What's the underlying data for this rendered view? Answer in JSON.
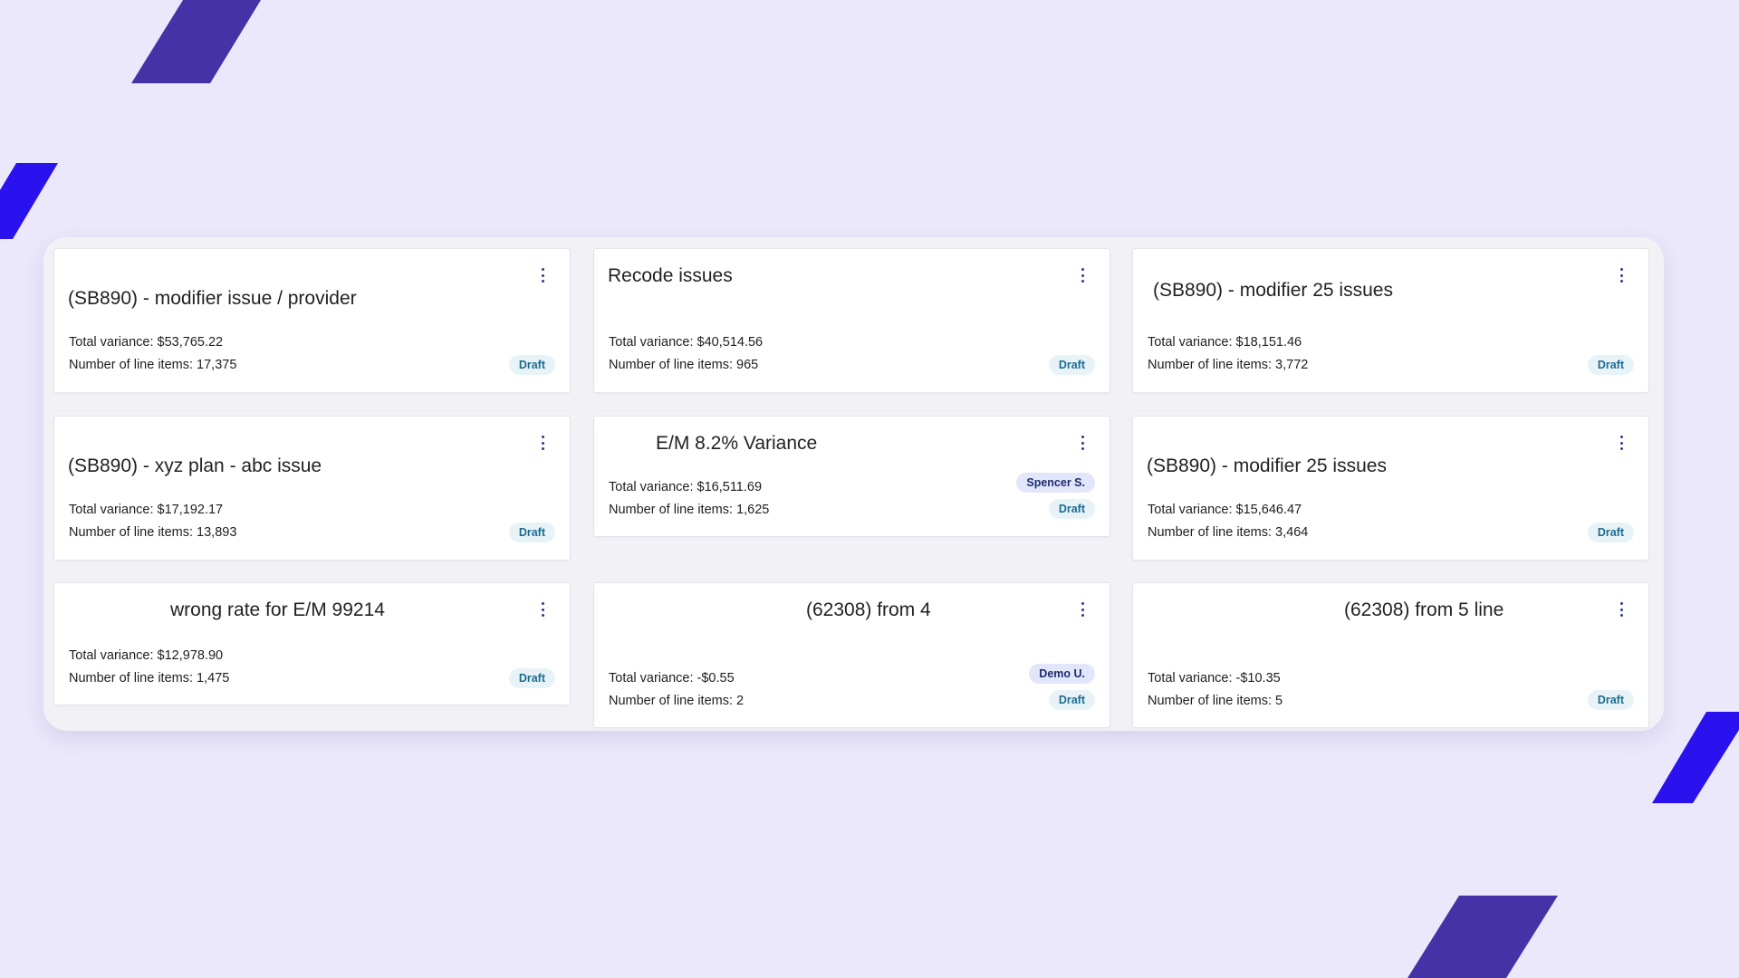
{
  "colors": {
    "background": "#ebe8fc",
    "panel": "#f2f1f6",
    "card": "#ffffff",
    "accent_dark": "#4532a6",
    "accent_bright": "#2a12ee",
    "draft_badge_bg": "#e8f3f8",
    "draft_badge_text": "#1d6b91",
    "user_badge_bg": "#e1e6fa",
    "user_badge_text": "#1f2b6e",
    "kebab_icon": "#2e3a8c"
  },
  "labels": {
    "total_variance": "Total variance: ",
    "line_items": "Number of line items: "
  },
  "cards": [
    {
      "title": "(SB890) - modifier issue / provider",
      "total_variance": "$53,765.22",
      "line_items": "17,375",
      "status": "Draft",
      "assignee": ""
    },
    {
      "title": "Recode issues",
      "total_variance": "$40,514.56",
      "line_items": "965",
      "status": "Draft",
      "assignee": ""
    },
    {
      "title": "(SB890) - modifier 25 issues",
      "total_variance": "$18,151.46",
      "line_items": "3,772",
      "status": "Draft",
      "assignee": ""
    },
    {
      "title": "(SB890) - xyz plan - abc issue",
      "total_variance": "$17,192.17",
      "line_items": "13,893",
      "status": "Draft",
      "assignee": ""
    },
    {
      "title": "E/M 8.2% Variance",
      "total_variance": "$16,511.69",
      "line_items": "1,625",
      "status": "Draft",
      "assignee": "Spencer S."
    },
    {
      "title": "(SB890) - modifier 25 issues",
      "total_variance": "$15,646.47",
      "line_items": "3,464",
      "status": "Draft",
      "assignee": ""
    },
    {
      "title": "wrong rate for E/M 99214",
      "total_variance": "$12,978.90",
      "line_items": "1,475",
      "status": "Draft",
      "assignee": ""
    },
    {
      "title": "(62308) from 4",
      "total_variance": "-$0.55",
      "line_items": "2",
      "status": "Draft",
      "assignee": "Demo U."
    },
    {
      "title": "(62308) from 5 line",
      "total_variance": "-$10.35",
      "line_items": "5",
      "status": "Draft",
      "assignee": ""
    }
  ]
}
